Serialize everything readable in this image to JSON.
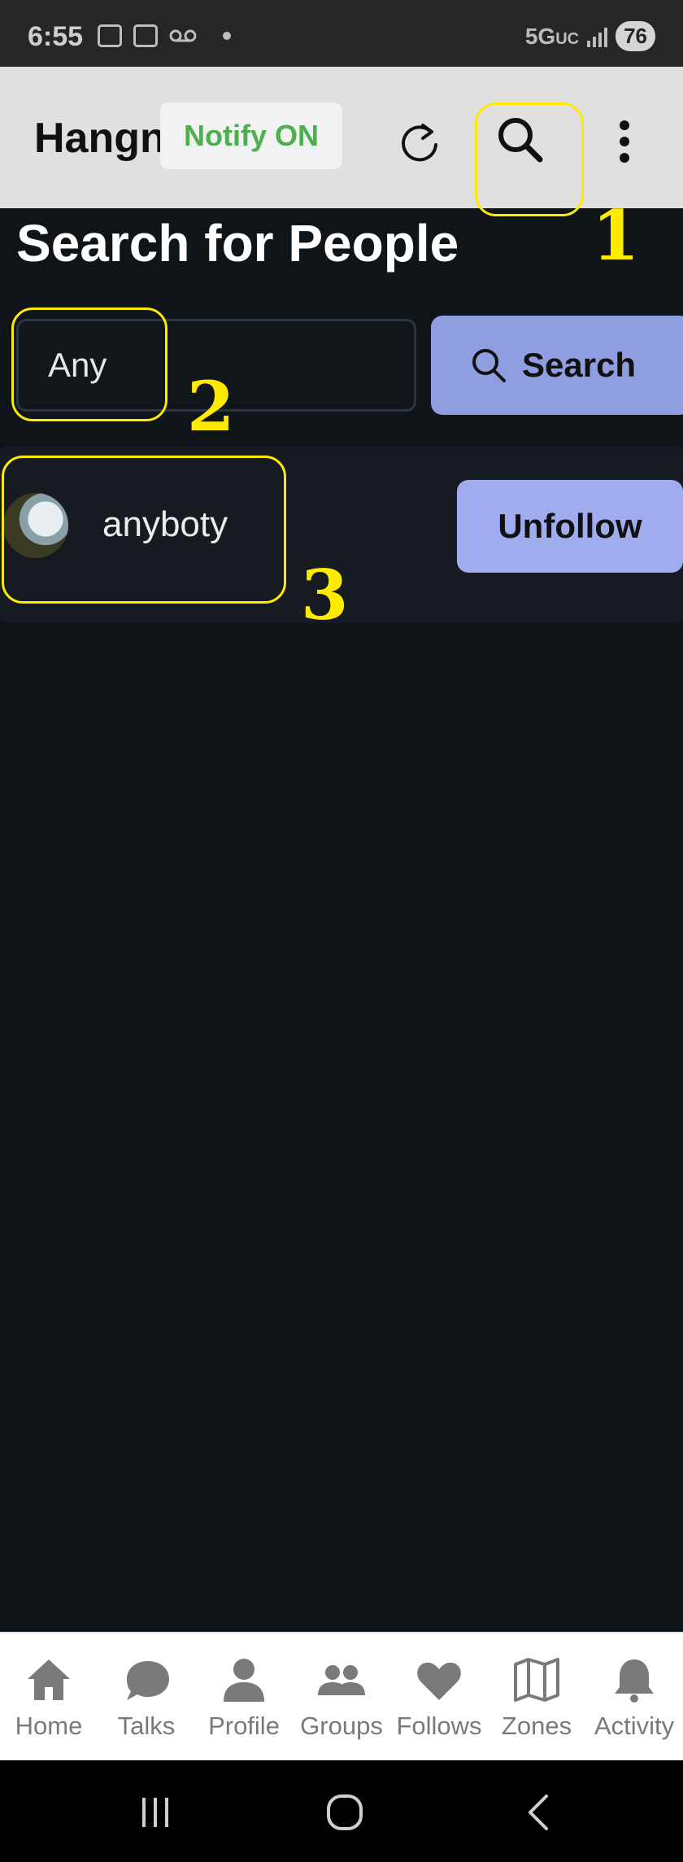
{
  "status_bar": {
    "time": "6:55",
    "network": "5G",
    "network_suffix": "UC",
    "battery": "76"
  },
  "app_bar": {
    "title": "Hangn",
    "notify_label": "Notify ON"
  },
  "page": {
    "title": "Search for People",
    "search_value": "Any",
    "search_button_label": "Search"
  },
  "results": [
    {
      "username": "anyboty",
      "action_label": "Unfollow"
    }
  ],
  "annotations": {
    "one": "1",
    "two": "2",
    "three": "3"
  },
  "bottom_nav": {
    "home": "Home",
    "talks": "Talks",
    "profile": "Profile",
    "groups": "Groups",
    "follows": "Follows",
    "zones": "Zones",
    "activity": "Activity"
  },
  "colors": {
    "accent": "#8e9ee0",
    "notify_green": "#4caf50",
    "annotation_yellow": "#ffeb00",
    "background": "#0f1418"
  }
}
